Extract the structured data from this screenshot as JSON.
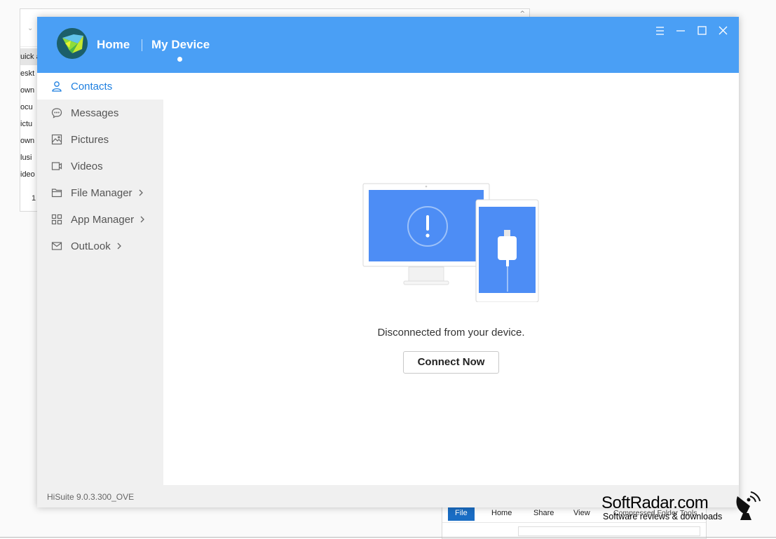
{
  "app": {
    "nav_home": "Home",
    "nav_device": "My Device",
    "version": "HiSuite 9.0.3.300_OVE"
  },
  "window_controls": [
    "menu-icon",
    "minimize-icon",
    "maximize-icon",
    "close-icon"
  ],
  "sidebar": {
    "items": [
      {
        "label": "Contacts",
        "icon": "contacts-icon",
        "active": true,
        "has_submenu": false
      },
      {
        "label": "Messages",
        "icon": "messages-icon",
        "active": false,
        "has_submenu": false
      },
      {
        "label": "Pictures",
        "icon": "pictures-icon",
        "active": false,
        "has_submenu": false
      },
      {
        "label": "Videos",
        "icon": "videos-icon",
        "active": false,
        "has_submenu": false
      },
      {
        "label": "File Manager",
        "icon": "folder-icon",
        "active": false,
        "has_submenu": true
      },
      {
        "label": "App Manager",
        "icon": "app-grid-icon",
        "active": false,
        "has_submenu": true
      },
      {
        "label": "OutLook",
        "icon": "mail-icon",
        "active": false,
        "has_submenu": true
      }
    ]
  },
  "main": {
    "message": "Disconnected from your device.",
    "connect_label": "Connect Now"
  },
  "background_window": {
    "nav_items": [
      "uick a",
      "eskt",
      "own",
      "ocu",
      "ictu",
      "own",
      "lusi",
      "ideo"
    ],
    "page_number": "1"
  },
  "background_window2": {
    "ribbon_tabs": [
      "File",
      "Home",
      "Share",
      "View",
      "Compressed Folder Tools"
    ]
  },
  "watermark": {
    "title": "SoftRadar.com",
    "subtitle": "Software reviews & downloads"
  },
  "colors": {
    "titlebar": "#4a9ff5",
    "accent": "#1e7fe0",
    "sidebar_bg": "#f0f0f0",
    "screen_blue": "#4d8df5"
  }
}
